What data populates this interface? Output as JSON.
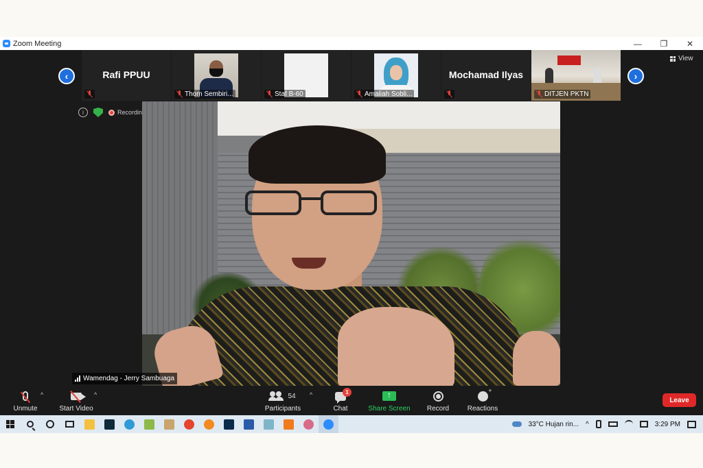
{
  "window": {
    "title": "Zoom Meeting",
    "minimize": "—",
    "restore": "❐",
    "close": "✕"
  },
  "strip": {
    "prev_arrow": "‹",
    "next_arrow": "›",
    "tiles": [
      {
        "big_name": "Rafi PPUU",
        "label": ""
      },
      {
        "big_name": "",
        "label": "Thom Sembiri..."
      },
      {
        "big_name": "",
        "label": "Staf B-60"
      },
      {
        "big_name": "",
        "label": "Amaliah Sobli..."
      },
      {
        "big_name": "Mochamad Ilyas",
        "label": ""
      },
      {
        "big_name": "",
        "label": "DITJEN PKTN"
      }
    ]
  },
  "view_button": "View",
  "status": {
    "info": "i",
    "recording": "Recording"
  },
  "speaker": {
    "name": "Wamendag - Jerry Sambuaga"
  },
  "toolbar": {
    "unmute": "Unmute",
    "start_video": "Start Video",
    "participants": "Participants",
    "participants_count": "54",
    "chat": "Chat",
    "chat_badge": "1",
    "share_screen": "Share Screen",
    "record": "Record",
    "reactions": "Reactions",
    "leave": "Leave",
    "caret": "^"
  },
  "taskbar": {
    "weather": "33°C  Hujan rin...",
    "chevron": "^",
    "time": "3:29 PM"
  },
  "colors": {
    "accent": "#2d8cff",
    "leave": "#e02828",
    "share": "#2bbd55",
    "muted": "#e0433b"
  }
}
